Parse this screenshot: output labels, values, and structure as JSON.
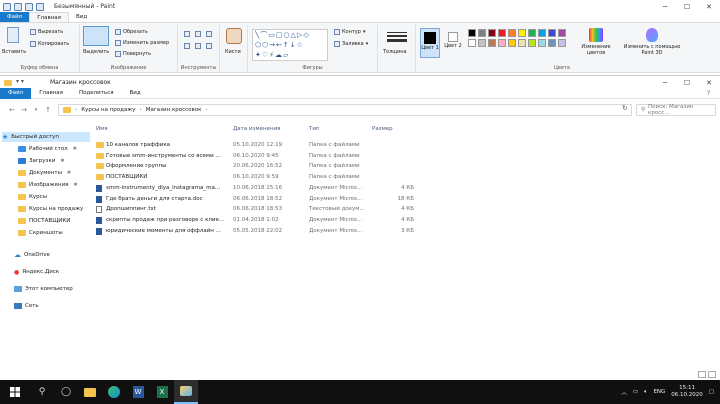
{
  "paint": {
    "title": "Безымянный - Paint",
    "tabs": [
      "Файл",
      "Главная",
      "Вид"
    ],
    "clipboard": {
      "paste": "Вставить",
      "cut": "Вырезать",
      "copy": "Копировать",
      "group": "Буфер обмена"
    },
    "image": {
      "select": "Выделить",
      "crop": "Обрезать",
      "resize": "Изменить размер",
      "rotate": "Повернуть",
      "group": "Изображение"
    },
    "tools": {
      "group": "Инструменты"
    },
    "brushes": "Кисти",
    "shapes": {
      "outline": "Контур",
      "fill": "Заливка",
      "group": "Фигуры"
    },
    "size": "Толщина",
    "colors": {
      "color1": "Цвет 1",
      "color2": "Цвет 2",
      "group": "Цвета",
      "edit": "Изменение цветов",
      "paint3d": "Изменить с помощью Paint 3D"
    },
    "palette": [
      "#000000",
      "#7f7f7f",
      "#880015",
      "#ed1c24",
      "#ff7f27",
      "#fff200",
      "#22b14c",
      "#00a2e8",
      "#3f48cc",
      "#a349a4",
      "#ffffff",
      "#c3c3c3",
      "#b97a57",
      "#ffaec9",
      "#ffc90e",
      "#efe4b0",
      "#b5e61d",
      "#99d9ea",
      "#7092be",
      "#c8bfe7"
    ]
  },
  "explorer": {
    "title": "Магазин кроссовок",
    "tabs": [
      "Файл",
      "Главная",
      "Поделиться",
      "Вид"
    ],
    "breadcrumb": [
      "Курсы на продажу",
      "Магазин кроссовок"
    ],
    "search_placeholder": "Поиск: Магазин кросс...",
    "columns": {
      "name": "Имя",
      "date": "Дата изменения",
      "type": "Тип",
      "size": "Размер"
    },
    "nav": {
      "quick_access": "Быстрый доступ",
      "items": [
        "Рабочий стол",
        "Загрузки",
        "Документы",
        "Изображения",
        "Курсы",
        "Курсы на продажу",
        "ПОСТАВЩИКИ",
        "Скриншоты"
      ],
      "onedrive": "OneDrive",
      "yandex": "Яндекс.Диск",
      "this_pc": "Этот компьютер",
      "network": "Сеть"
    },
    "files": [
      {
        "name": "10 каналов траффика",
        "date": "05.10.2020 12:19",
        "type": "Папка с файлами",
        "size": "",
        "kind": "folder"
      },
      {
        "name": "Готовые smm-инструменты со всеми ...",
        "date": "06.10.2020 9:45",
        "type": "Папка с файлами",
        "size": "",
        "kind": "folder"
      },
      {
        "name": "Оформление группы",
        "date": "20.06.2020 16:52",
        "type": "Папка с файлами",
        "size": "",
        "kind": "folder"
      },
      {
        "name": "ПОСТАВЩИКИ",
        "date": "06.10.2020 9:59",
        "type": "Папка с файлами",
        "size": "",
        "kind": "folder"
      },
      {
        "name": "smm-instrumenty_dlya_instagrama_ma...",
        "date": "10.06.2018 15:16",
        "type": "Документ Micros...",
        "size": "4 КБ",
        "kind": "doc"
      },
      {
        "name": "Где брать деньги для старта.doc",
        "date": "06.06.2018 18:52",
        "type": "Документ Micros...",
        "size": "18 КБ",
        "kind": "doc"
      },
      {
        "name": "Дропшиппинг.txt",
        "date": "06.06.2018 18:53",
        "type": "Текстовый докум...",
        "size": "4 КБ",
        "kind": "txt"
      },
      {
        "name": "скрипты продаж при разговоре с клие...",
        "date": "01.04.2018 1:02",
        "type": "Документ Micros...",
        "size": "4 КБ",
        "kind": "doc"
      },
      {
        "name": "юридические моменты для оффлайн ...",
        "date": "05.05.2018 22:02",
        "type": "Документ Micros...",
        "size": "3 КБ",
        "kind": "doc"
      }
    ]
  },
  "taskbar": {
    "lang": "ENG",
    "time": "15:11",
    "date": "06.10.2020"
  }
}
